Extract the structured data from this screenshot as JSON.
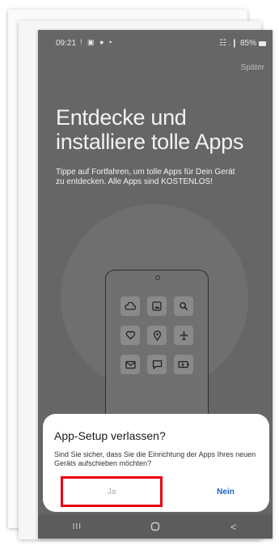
{
  "status_bar": {
    "time": "09:21",
    "left_icons": "! ▣ ● •",
    "signal": "☷ .❙",
    "battery": "85%"
  },
  "onboarding": {
    "skip_label": "Später",
    "headline": "Entdecke und installiere tolle Apps",
    "description": "Tippe auf Fortfahren, um tolle Apps für Dein Gerät zu entdecken. Alle Apps sind KOSTENLOS!",
    "app_icons": [
      "cloud-icon",
      "image-icon",
      "search-icon",
      "heart-icon",
      "location-pin-icon",
      "airplane-icon",
      "mail-icon",
      "chat-icon",
      "battery-icon"
    ]
  },
  "dialog": {
    "title": "App-Setup verlassen?",
    "message": "Sind Sie sicher, dass Sie die Einrichtung der Apps Ihres neuen Geräts aufschieben möchten?",
    "confirm_label": "Ja",
    "cancel_label": "Nein"
  },
  "nav_bar": {
    "recents_glyph": "III",
    "back_glyph": "<"
  },
  "colors": {
    "highlight_border": "#e8000f",
    "primary_action": "#1f62c9",
    "scrim_background": "#666666"
  }
}
